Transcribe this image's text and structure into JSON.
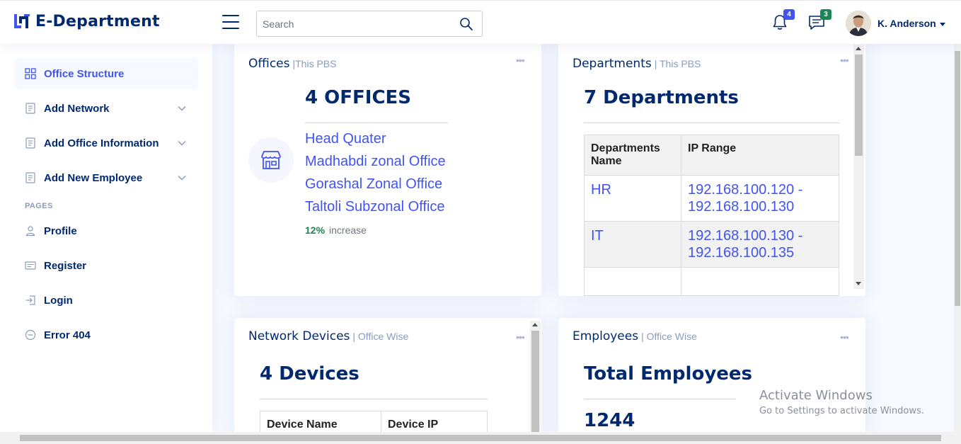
{
  "header": {
    "logo_text": "E-Department",
    "search_placeholder": "Search",
    "notifications_count": "4",
    "messages_count": "3",
    "user_name": "K. Anderson"
  },
  "sidebar": {
    "items": [
      {
        "label": "Office Structure",
        "icon": "grid-icon",
        "active": true
      },
      {
        "label": "Add Network",
        "icon": "document-icon"
      },
      {
        "label": "Add Office Information",
        "icon": "document-icon"
      },
      {
        "label": "Add New Employee",
        "icon": "document-icon"
      }
    ],
    "pages_heading": "PAGES",
    "pages": [
      {
        "label": "Profile",
        "icon": "person-icon"
      },
      {
        "label": "Register",
        "icon": "card-icon"
      },
      {
        "label": "Login",
        "icon": "login-icon"
      },
      {
        "label": "Error 404",
        "icon": "dash-circle-icon"
      }
    ]
  },
  "offices": {
    "title": "Offices",
    "subtitle": "|This PBS",
    "headline": "4 OFFICES",
    "list": [
      "Head Quater",
      "Madhabdi zonal Office",
      "Gorashal Zonal Office",
      "Taltoli Subzonal Office"
    ],
    "percent": "12%",
    "percent_label": "increase"
  },
  "departments": {
    "title": "Departments",
    "subtitle": "| This PBS",
    "headline": "7 Departments",
    "columns": [
      "Departments Name",
      "IP Range"
    ],
    "rows": [
      {
        "name": "HR",
        "range": "192.168.100.120 - 192.168.100.130"
      },
      {
        "name": "IT",
        "range": "192.168.100.130 - 192.168.100.135"
      }
    ]
  },
  "network_devices": {
    "title": "Network Devices",
    "subtitle": "| Office Wise",
    "headline": "4 Devices",
    "columns": [
      "Device Name",
      "Device IP"
    ]
  },
  "employees": {
    "title": "Employees",
    "subtitle": "| Office Wise",
    "headline": "Total Employees",
    "count": "1244"
  },
  "watermark": {
    "line1": "Activate Windows",
    "line2": "Go to Settings to activate Windows."
  },
  "colors": {
    "primary": "#4154f1",
    "navy": "#012970",
    "muted": "#899bbd",
    "success": "#198754"
  }
}
